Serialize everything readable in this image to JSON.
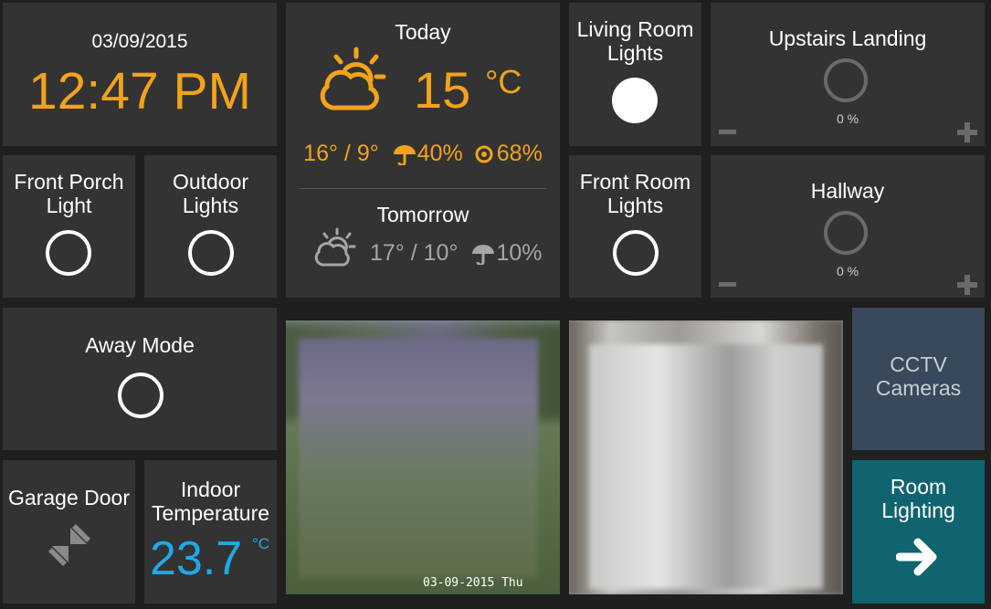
{
  "clock": {
    "date": "03/09/2015",
    "time": "12:47 PM"
  },
  "weather": {
    "today": {
      "label": "Today",
      "temp": "15",
      "unit": "°C",
      "hilo": "16° / 9°",
      "rain": "40%",
      "humidity": "68%"
    },
    "tomorrow": {
      "label": "Tomorrow",
      "hilo": "17° / 10°",
      "rain": "10%"
    }
  },
  "living_room": {
    "label": "Living Room Lights",
    "state": "on"
  },
  "upstairs_landing": {
    "label": "Upstairs Landing",
    "level": "0 %"
  },
  "front_porch": {
    "label": "Front Porch Light"
  },
  "outdoor": {
    "label": "Outdoor Lights"
  },
  "front_room": {
    "label": "Front Room Lights"
  },
  "hallway": {
    "label": "Hallway",
    "level": "0 %"
  },
  "away_mode": {
    "label": "Away Mode"
  },
  "garage": {
    "label": "Garage Door"
  },
  "indoor_temp": {
    "label": "Indoor Temperature",
    "value": "23.7",
    "unit": "°C"
  },
  "camera1": {
    "timestamp": "03-09-2015 Thu"
  },
  "cctv": {
    "label": "CCTV Cameras"
  },
  "room_lighting": {
    "label": "Room Lighting"
  },
  "colors": {
    "accent": "#f2a31b",
    "blue": "#1ea9e8",
    "cctv": "#37495a",
    "room": "#0f6470",
    "tile": "#333333"
  }
}
